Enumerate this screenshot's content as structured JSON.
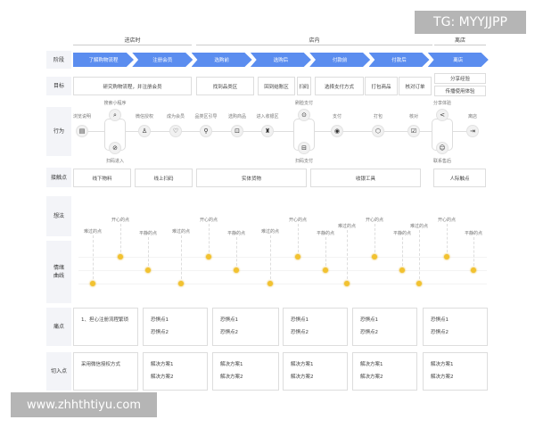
{
  "sections": [
    {
      "label": "进店时"
    },
    {
      "label": "店内"
    },
    {
      "label": "离店"
    }
  ],
  "row_labels": {
    "stage": "阶段",
    "goal": "目标",
    "behavior": "行为",
    "touchpoint": "接触点",
    "thought": "想法",
    "emotion": "情绪\n曲线",
    "pain": "痛点",
    "entry": "切入点"
  },
  "stages": [
    "了解购物流程",
    "注册会员",
    "选购前",
    "选购后",
    "付款前",
    "付款后",
    "离店"
  ],
  "stage_color": "#5b8def",
  "goals": [
    "研究购物流程，并注册会员",
    "找到品类区",
    "回到结账区",
    "扫码",
    "选择支付方式",
    "打包商品",
    "核对订单",
    "分享经验",
    "传播使用体验"
  ],
  "actions": [
    {
      "label": "浏览说明",
      "icon": "document-icon",
      "glyph": "▤",
      "pos": "top-label"
    },
    {
      "label": "搜索小程序",
      "icon": "search-icon",
      "glyph": "⌕",
      "pos": "upper"
    },
    {
      "label": "扫码进入",
      "icon": "compass-icon",
      "glyph": "⊘",
      "pos": "lower"
    },
    {
      "label": "微信授权",
      "icon": "user-icon",
      "glyph": "♙",
      "pos": "top-label"
    },
    {
      "label": "成为会员",
      "icon": "diamond-icon",
      "glyph": "♡",
      "pos": "top-label"
    },
    {
      "label": "品类区引导",
      "icon": "pin-icon",
      "glyph": "⚲",
      "pos": "top-label"
    },
    {
      "label": "选购商品",
      "icon": "cart-icon",
      "glyph": "⊡",
      "pos": "top-label"
    },
    {
      "label": "进入收银区",
      "icon": "money-bag-icon",
      "glyph": "♜",
      "pos": "top-label"
    },
    {
      "label": "刷脸支付",
      "icon": "face-scan-icon",
      "glyph": "⊙",
      "pos": "upper"
    },
    {
      "label": "扫码支付",
      "icon": "scan-icon",
      "glyph": "⊟",
      "pos": "lower"
    },
    {
      "label": "支付",
      "icon": "coin-icon",
      "glyph": "◉",
      "pos": "top-label"
    },
    {
      "label": "打包",
      "icon": "package-icon",
      "glyph": "⬡",
      "pos": "top-label"
    },
    {
      "label": "核对",
      "icon": "checklist-icon",
      "glyph": "☑",
      "pos": "top-label"
    },
    {
      "label": "分享体验",
      "icon": "share-icon",
      "glyph": "<",
      "pos": "upper"
    },
    {
      "label": "联系售后",
      "icon": "support-icon",
      "glyph": "☺",
      "pos": "lower"
    },
    {
      "label": "离店",
      "icon": "exit-icon",
      "glyph": "⇥",
      "pos": "top-label"
    }
  ],
  "touchpoints": [
    "线下物料",
    "线上扫码",
    "实体货物",
    "收银工具",
    "人际触点"
  ],
  "emotions": [
    {
      "label": "难过的点",
      "level": "sad"
    },
    {
      "label": "开心的点",
      "level": "happy"
    },
    {
      "label": "平静的点",
      "level": "calm"
    },
    {
      "label": "难过的点",
      "level": "sad"
    },
    {
      "label": "开心的点",
      "level": "happy"
    },
    {
      "label": "平静的点",
      "level": "calm"
    },
    {
      "label": "难过的点",
      "level": "sad"
    },
    {
      "label": "开心的点",
      "level": "happy"
    },
    {
      "label": "平静的点",
      "level": "calm"
    },
    {
      "label": "难过的点",
      "level": "sad"
    },
    {
      "label": "开心的点",
      "level": "happy"
    },
    {
      "label": "平静的点",
      "level": "calm"
    },
    {
      "label": "难过的点",
      "level": "sad"
    },
    {
      "label": "开心的点",
      "level": "happy"
    },
    {
      "label": "平静的点",
      "level": "calm"
    }
  ],
  "pain_points": [
    [
      "1、担心注册流程繁琐"
    ],
    [
      "恐惧点1",
      "恐惧点2"
    ],
    [
      "恐惧点1",
      "恐惧点2"
    ],
    [
      "恐惧点1",
      "恐惧点2"
    ],
    [
      "恐惧点1",
      "恐惧点2"
    ],
    [
      "恐惧点1",
      "恐惧点2"
    ]
  ],
  "entry_points": [
    [
      "采用微信授权方式"
    ],
    [
      "解决方案1",
      "解决方案2"
    ],
    [
      "解决方案1",
      "解决方案2"
    ],
    [
      "解决方案1",
      "解决方案2"
    ],
    [
      "解决方案1",
      "解决方案2"
    ],
    [
      "解决方案1",
      "解决方案2"
    ]
  ],
  "watermarks": {
    "top": "TG: MYYJJPP",
    "bottom": "www.zhhthtiyu.com"
  }
}
